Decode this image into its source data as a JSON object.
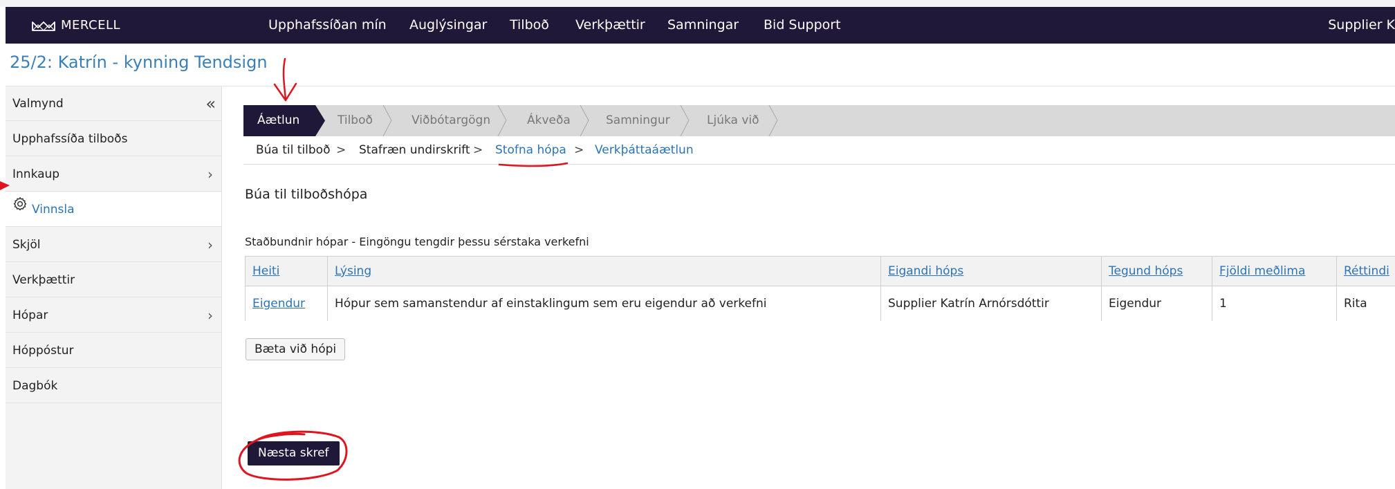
{
  "brand": {
    "logo_text": "MERCELL"
  },
  "nav": {
    "items": [
      "Upphafssíðan mín",
      "Auglýsingar",
      "Tilboð",
      "Verkþættir",
      "Samningar",
      "Bid Support"
    ],
    "user": "Supplier K"
  },
  "page_title": "25/2: Katrín - kynning Tendsign",
  "sidebar": {
    "collapse": "«",
    "items": [
      {
        "label": "Valmynd"
      },
      {
        "label": "Upphafssíða tilboðs"
      },
      {
        "label": "Innkaup"
      },
      {
        "label": "Vinnsla"
      },
      {
        "label": "Skjöl"
      },
      {
        "label": "Verkþættir"
      },
      {
        "label": "Hópar"
      },
      {
        "label": "Hóppóstur"
      },
      {
        "label": "Dagbók"
      }
    ]
  },
  "steps": [
    "Áætlun",
    "Tilboð",
    "Viðbótargögn",
    "Ákveða",
    "Samningur",
    "Ljúka við"
  ],
  "breadcrumbs": [
    "Búa til tilboð",
    "Stafræn undirskrift",
    "Stofna hópa",
    "Verkþáttaáætlun"
  ],
  "section_title": "Búa til tilboðshópa",
  "table": {
    "caption": "Staðbundnir hópar - Eingöngu tengdir þessu sérstaka verkefni",
    "headers": [
      "Heiti",
      "Lýsing",
      "Eigandi hóps",
      "Tegund hóps",
      "Fjöldi meðlima",
      "Réttindi"
    ],
    "rows": [
      [
        "Eigendur",
        "Hópur sem samanstendur af einstaklingum sem eru eigendur að verkefni",
        "Supplier Katrín Arnórsdóttir",
        "Eigendur",
        "1",
        "Rita"
      ]
    ]
  },
  "buttons": {
    "add_group": "Bæta við hópi",
    "next_step": "Næsta skref"
  },
  "colors": {
    "navbar": "#1f1838",
    "link": "#2c74b3",
    "annotation": "#e0141e"
  }
}
